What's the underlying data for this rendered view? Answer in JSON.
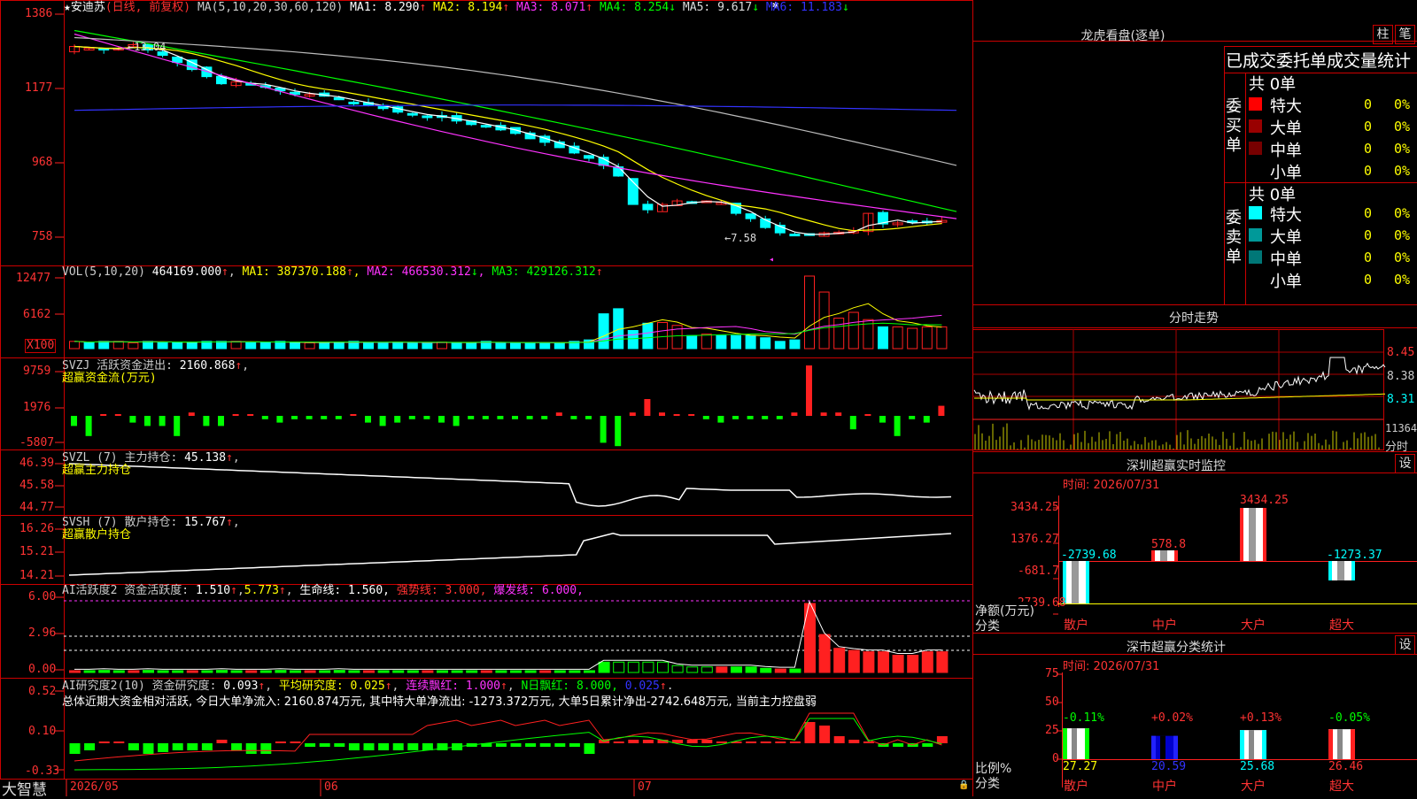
{
  "colors": {
    "red": "#ff2020",
    "cyan": "#00ffff",
    "green": "#00ff00",
    "white": "#ffffff",
    "yellow": "#ffff00",
    "magenta": "#ff33ff",
    "blue": "#3333ff",
    "gray": "#aaaaaa",
    "grid": "#aa0000",
    "frame": "#cc0000"
  },
  "chart": {
    "stock": "★安迪苏",
    "period": "(日线, 前复权)",
    "ma_title": "MA(5,10,20,30,60,120)",
    "ma": [
      {
        "name": "MA1",
        "value": "8.290",
        "arrow": "↑"
      },
      {
        "name": "MA2",
        "value": "8.194",
        "arrow": "↑"
      },
      {
        "name": "MA3",
        "value": "8.071",
        "arrow": "↑"
      },
      {
        "name": "MA4",
        "value": "8.254",
        "arrow": "↓"
      },
      {
        "name": "MA5",
        "value": "9.617",
        "arrow": "↓"
      },
      {
        "name": "MA6",
        "value": "11.183",
        "arrow": "↓"
      }
    ],
    "price_axis": [
      "1386",
      "1177",
      "968",
      "758"
    ],
    "high_marker": "13.04",
    "low_marker": "←7.58",
    "vol_title": "VOL(5,10,20)",
    "vol_value": "464169.000",
    "vol_ma": [
      {
        "name": "MA1",
        "value": "387370.188",
        "arrow": "↑"
      },
      {
        "name": "MA2",
        "value": "466530.312",
        "arrow": "↓"
      },
      {
        "name": "MA3",
        "value": "429126.312",
        "arrow": "↑"
      }
    ],
    "vol_axis": [
      "12477",
      "6162"
    ],
    "vol_unit": "X100",
    "svzj_title": "SVZJ  活跃资金进出:",
    "svzj_value": "2160.868",
    "svzj_sub": "超赢资金流(万元)",
    "svzj_axis": [
      "9759",
      "1976",
      "-5807"
    ],
    "svzl_title": "SVZL (7) 主力持仓:",
    "svzl_value": "45.138",
    "svzl_sub": "超赢主力持仓",
    "svzl_axis": [
      "46.39",
      "45.58",
      "44.77"
    ],
    "svsh_title": "SVSH (7) 散户持仓:",
    "svsh_value": "15.767",
    "svsh_sub": "超赢散户持仓",
    "svsh_axis": [
      "16.26",
      "15.21",
      "14.21"
    ],
    "ai1_title": "AI活跃度2 资金活跃度:",
    "ai1_value": "1.510",
    "ai1_v2": "5.773",
    "ai1_life": "生命线: 1.560,",
    "ai1_strong": "强势线: 3.000,",
    "ai1_burst": "爆发线: 6.000,",
    "ai1_axis": [
      "6.00",
      "2.96",
      "0.00"
    ],
    "ai2_title": "AI研究度2(10) 资金研究度:",
    "ai2_value": "0.093",
    "ai2_avg": "平均研究度: 0.025",
    "ai2_cont": "连续飘红: 1.000",
    "ai2_n": "N日飘红: 8.000,",
    "ai2_last": "0.025",
    "ai2_axis": [
      "0.52",
      "0.10",
      "-0.33"
    ],
    "summary": "总体近期大资金相对活跃, 今日大单净流入: 2160.874万元, 其中特大单净流出: -1273.372万元, 大单5日累计净出-2742.648万元, 当前主力控盘弱",
    "date_labels": [
      "2026/05",
      "06",
      "07"
    ],
    "logo": "大智慧"
  },
  "chart_data": {
    "type": "bar",
    "title": "龙虎看盘(逐单)",
    "categories": [
      "特大",
      "大单",
      "中单",
      "小单"
    ],
    "series": [
      {
        "name": "委买单",
        "values": [
          0,
          0,
          0,
          0
        ]
      },
      {
        "name": "委卖单",
        "values": [
          0,
          0,
          0,
          0
        ]
      }
    ]
  },
  "panel": {
    "title": "龙虎看盘(逐单)",
    "btn1": "柱",
    "btn2": "笔",
    "header": "已成交委托单成交量统计",
    "buy_label": "委买单",
    "sell_label": "委卖单",
    "count_buy": "共 0单",
    "count_sell": "共 0单",
    "buy_rows": [
      {
        "name": "特大",
        "val": "0",
        "pct": "0%",
        "color": "#ff0000"
      },
      {
        "name": "大单",
        "val": "0",
        "pct": "0%",
        "color": "#990000"
      },
      {
        "name": "中单",
        "val": "0",
        "pct": "0%",
        "color": "#770000"
      },
      {
        "name": "小单",
        "val": "0",
        "pct": "0%",
        "color": ""
      }
    ],
    "sell_rows": [
      {
        "name": "特大",
        "val": "0",
        "pct": "0%",
        "color": "#00ffff"
      },
      {
        "name": "大单",
        "val": "0",
        "pct": "0%",
        "color": "#009999"
      },
      {
        "name": "中单",
        "val": "0",
        "pct": "0%",
        "color": "#007777"
      },
      {
        "name": "小单",
        "val": "0",
        "pct": "0%",
        "color": ""
      }
    ]
  },
  "intraday": {
    "title": "分时走势",
    "prices": [
      "8.45",
      "8.38",
      "8.31"
    ],
    "vol": "11364",
    "unit": "分时"
  },
  "monitor": {
    "title": "深圳超赢实时监控",
    "btn": "设",
    "time": "时间: 2026/07/31",
    "axis": [
      "3434.25",
      "1376.27",
      "-681.7",
      "-2739.68"
    ],
    "ylabel": "净额(万元)",
    "xlabel": "分类",
    "bars": [
      {
        "label": "散户",
        "value": "-2739.68"
      },
      {
        "label": "中户",
        "value": "578.8"
      },
      {
        "label": "大户",
        "value": "3434.25"
      },
      {
        "label": "超大",
        "value": "-1273.37"
      }
    ]
  },
  "classify": {
    "title": "深市超赢分类统计",
    "btn": "设",
    "time": "时间: 2026/07/31",
    "axis": [
      "75",
      "50",
      "25",
      "0"
    ],
    "ylabel": "比例%",
    "xlabel": "分类",
    "bars": [
      {
        "label": "散户",
        "pct": "-0.11%",
        "value": "27.27"
      },
      {
        "label": "中户",
        "pct": "+0.02%",
        "value": "20.59"
      },
      {
        "label": "大户",
        "pct": "+0.13%",
        "value": "25.68"
      },
      {
        "label": "超大",
        "pct": "-0.05%",
        "value": "26.46"
      }
    ]
  }
}
